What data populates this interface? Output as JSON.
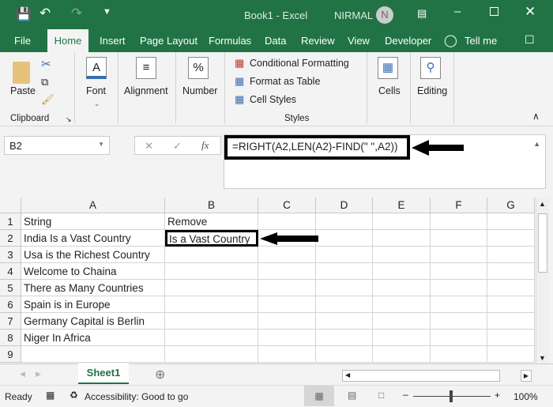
{
  "title": {
    "doc": "Book1  -  Excel",
    "user": "NIRMAL",
    "avatar": "N"
  },
  "tabs": [
    "File",
    "Home",
    "Insert",
    "Page Layout",
    "Formulas",
    "Data",
    "Review",
    "View",
    "Developer",
    "Tell me"
  ],
  "ribbon": {
    "paste": "Paste",
    "clipboard": "Clipboard",
    "font": "Font",
    "alignment": "Alignment",
    "number": "Number",
    "cond": "Conditional Formatting",
    "fat": "Format as Table",
    "cellstyles": "Cell Styles",
    "styles": "Styles",
    "cells": "Cells",
    "editing": "Editing"
  },
  "namebox": "B2",
  "formula": "=RIGHT(A2,LEN(A2)-FIND(\" \",A2))",
  "columns": [
    "A",
    "B",
    "C",
    "D",
    "E",
    "F",
    "G"
  ],
  "rows": [
    {
      "n": "1",
      "a": "String",
      "b": "Remove"
    },
    {
      "n": "2",
      "a": "India Is a Vast Country",
      "b": "Is a Vast Country"
    },
    {
      "n": "3",
      "a": "Usa is the Richest Country",
      "b": ""
    },
    {
      "n": "4",
      "a": "Welcome to Chaina",
      "b": ""
    },
    {
      "n": "5",
      "a": "There as Many Countries",
      "b": ""
    },
    {
      "n": "6",
      "a": "Spain is in Europe",
      "b": ""
    },
    {
      "n": "7",
      "a": "Germany Capital is Berlin",
      "b": ""
    },
    {
      "n": "8",
      "a": "Niger In Africa",
      "b": ""
    },
    {
      "n": "9",
      "a": "",
      "b": ""
    }
  ],
  "sheet": "Sheet1",
  "status": {
    "ready": "Ready",
    "accessibility": "Accessibility: Good to go",
    "zoom": "100%"
  },
  "colors": {
    "accent": "#217346"
  }
}
